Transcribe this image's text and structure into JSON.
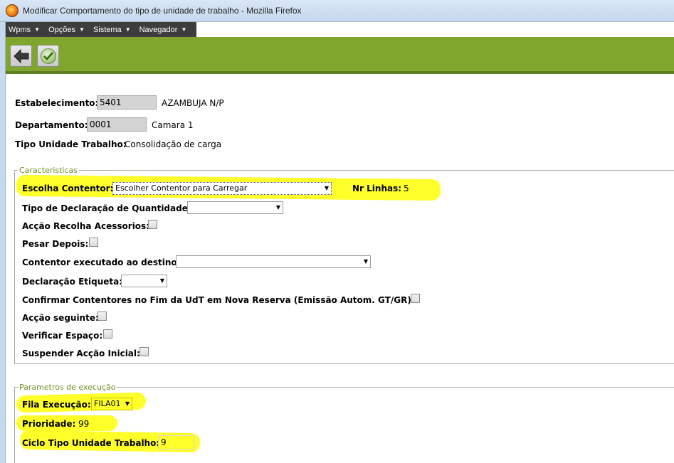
{
  "window": {
    "title": "Modificar Comportamento do tipo de unidade de trabalho - Mozilla Firefox"
  },
  "menu": [
    {
      "label": "Wpms"
    },
    {
      "label": "Opções"
    },
    {
      "label": "Sistema"
    },
    {
      "label": "Navegador"
    }
  ],
  "toolbar": {
    "back_icon": "arrow-left-icon",
    "confirm_icon": "check-icon"
  },
  "header": {
    "estabelecimento_label": "Estabelecimento:",
    "estabelecimento_value": "5401",
    "estabelecimento_name": "AZAMBUJA N/P",
    "departamento_label": "Departamento:",
    "departamento_value": "0001",
    "departamento_name": "Camara 1",
    "tipo_label": "Tipo Unidade Trabalho:",
    "tipo_value": "Consolidação de carga"
  },
  "caracteristicas": {
    "legend": "Caracteristicas",
    "escolha_label": "Escolha Contentor:",
    "escolha_value": "Escolher Contentor para Carregar",
    "nr_linhas_label": "Nr Linhas:",
    "nr_linhas_value": "5",
    "tipo_declaracao_label": "Tipo de Declaração de Quantidade:",
    "accao_recolha_label": "Acção Recolha Acessorios:",
    "pesar_label": "Pesar Depois:",
    "contentor_destino_label": "Contentor executado ao destino:",
    "declaracao_etiqueta_label": "Declaração Etiqueta:",
    "confirmar_label": "Confirmar Contentores no Fim da UdT em Nova Reserva (Emissão Autom. GT/GR):",
    "accao_seguinte_label": "Acção seguinte:",
    "verificar_label": "Verificar Espaço:",
    "suspender_label": "Suspender Acção Inicial:"
  },
  "execucao": {
    "legend": "Parametros de execução",
    "fila_label": "Fila Execução:",
    "fila_value": "FILA01",
    "prioridade_label": "Prioridade:",
    "prioridade_value": "99",
    "ciclo_label": "Ciclo Tipo Unidade Trabalho:",
    "ciclo_value": "9"
  },
  "colors": {
    "toolbar_green": "#80a62e",
    "legend_green": "#6f9125",
    "highlight": "#ffff2a"
  }
}
